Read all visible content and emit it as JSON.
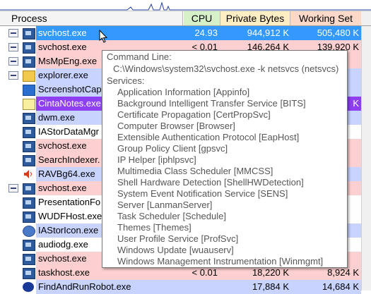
{
  "header": {
    "process": "Process",
    "cpu": "CPU",
    "private_bytes": "Private Bytes",
    "working_set": "Working Set"
  },
  "colors": {
    "service_row": "#fcd0d0",
    "own_row": "#c8d4ff",
    "selected_row": "#3399ff",
    "suspended_row": "#8f3ff2",
    "plain_row": "#ffffff"
  },
  "rows": [
    {
      "name": "svchost.exe",
      "cpu": "24.93",
      "private_bytes": "944,912 K",
      "working_set": "505,480 K",
      "tree": true,
      "icon": "window-icon",
      "style": "selected"
    },
    {
      "name": "svchost.exe",
      "cpu": "< 0.01",
      "private_bytes": "146,264 K",
      "working_set": "139,920 K",
      "tree": true,
      "icon": "window-icon",
      "style": "service"
    },
    {
      "name": "MsMpEng.exe",
      "cpu": "",
      "private_bytes": "",
      "working_set": "",
      "tree": true,
      "icon": "window-icon",
      "style": "service"
    },
    {
      "name": "explorer.exe",
      "cpu": "",
      "private_bytes": "",
      "working_set": "",
      "tree": true,
      "icon": "folder-icon",
      "style": "own"
    },
    {
      "name": "ScreenshotCap",
      "cpu": "",
      "private_bytes": "",
      "working_set": "",
      "tree": false,
      "icon": "screenshot-icon",
      "style": "own"
    },
    {
      "name": "CintaNotes.exe",
      "cpu": "",
      "private_bytes": "",
      "working_set": "K",
      "tree": false,
      "icon": "notes-icon",
      "style": "suspended"
    },
    {
      "name": "dwm.exe",
      "cpu": "",
      "private_bytes": "",
      "working_set": "",
      "tree": false,
      "icon": "window-icon",
      "style": "own"
    },
    {
      "name": "IAStorDataMgr",
      "cpu": "",
      "private_bytes": "",
      "working_set": "",
      "tree": false,
      "icon": "window-icon",
      "style": "plain"
    },
    {
      "name": "svchost.exe",
      "cpu": "",
      "private_bytes": "",
      "working_set": "",
      "tree": false,
      "icon": "window-icon",
      "style": "service"
    },
    {
      "name": "SearchIndexer.",
      "cpu": "",
      "private_bytes": "",
      "working_set": "",
      "tree": false,
      "icon": "window-icon",
      "style": "service"
    },
    {
      "name": "RAVBg64.exe",
      "cpu": "",
      "private_bytes": "",
      "working_set": "",
      "tree": false,
      "icon": "speaker-icon",
      "style": "own"
    },
    {
      "name": "svchost.exe",
      "cpu": "",
      "private_bytes": "",
      "working_set": "",
      "tree": true,
      "icon": "window-icon",
      "style": "service"
    },
    {
      "name": "PresentationFo",
      "cpu": "",
      "private_bytes": "",
      "working_set": "",
      "tree": false,
      "icon": "window-icon",
      "style": "plain"
    },
    {
      "name": "WUDFHost.exe",
      "cpu": "",
      "private_bytes": "",
      "working_set": "",
      "tree": false,
      "icon": "window-icon",
      "style": "plain"
    },
    {
      "name": "IAStorIcon.exe",
      "cpu": "",
      "private_bytes": "",
      "working_set": "",
      "tree": false,
      "icon": "storage-icon",
      "style": "own"
    },
    {
      "name": "audiodg.exe",
      "cpu": "",
      "private_bytes": "",
      "working_set": "",
      "tree": false,
      "icon": "window-icon",
      "style": "plain"
    },
    {
      "name": "svchost.exe",
      "cpu": "",
      "private_bytes": "",
      "working_set": "",
      "tree": false,
      "icon": "window-icon",
      "style": "service"
    },
    {
      "name": "taskhost.exe",
      "cpu": "< 0.01",
      "private_bytes": "18,220 K",
      "working_set": "8,924 K",
      "tree": false,
      "icon": "window-icon",
      "style": "service"
    },
    {
      "name": "FindAndRunRobot.exe",
      "cpu": "",
      "private_bytes": "17,884 K",
      "working_set": "14,684 K",
      "tree": false,
      "icon": "robot-icon",
      "style": "own"
    }
  ],
  "tooltip": {
    "command_line_label": "Command Line:",
    "command_line": "C:\\Windows\\system32\\svchost.exe -k netsvcs (netsvcs)",
    "services_label": "Services:",
    "services": [
      "Application Information [Appinfo]",
      "Background Intelligent Transfer Service [BITS]",
      "Certificate Propagation [CertPropSvc]",
      "Computer Browser [Browser]",
      "Extensible Authentication Protocol [EapHost]",
      "Group Policy Client [gpsvc]",
      "IP Helper [iphlpsvc]",
      "Multimedia Class Scheduler [MMCSS]",
      "Shell Hardware Detection [ShellHWDetection]",
      "System Event Notification Service [SENS]",
      "Server [LanmanServer]",
      "Task Scheduler [Schedule]",
      "Themes [Themes]",
      "User Profile Service [ProfSvc]",
      "Windows Update [wuauserv]",
      "Windows Management Instrumentation [Winmgmt]"
    ]
  }
}
